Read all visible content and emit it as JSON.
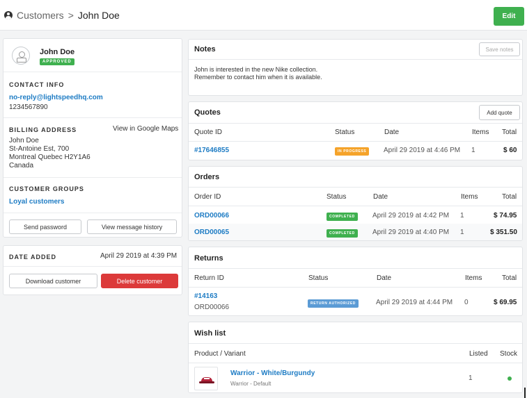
{
  "breadcrumb": {
    "parent": "Customers",
    "separator": ">",
    "current": "John Doe"
  },
  "header": {
    "edit_label": "Edit"
  },
  "customer": {
    "name": "John Doe",
    "status": "APPROVED"
  },
  "contact": {
    "title": "CONTACT INFO",
    "email": "no-reply@lightspeedhq.com",
    "phone": "1234567890"
  },
  "billing": {
    "title": "BILLING ADDRESS",
    "maps_link": "View in Google Maps",
    "lines": [
      "John Doe",
      "St-Antoine Est, 700",
      "Montreal Quebec H2Y1A6",
      "Canada"
    ]
  },
  "groups": {
    "title": "CUSTOMER GROUPS",
    "value": "Loyal customers"
  },
  "actions": {
    "send_password": "Send password",
    "view_history": "View message history"
  },
  "date_added": {
    "title": "DATE ADDED",
    "value": "April 29 2019 at 4:39 PM"
  },
  "actions2": {
    "download": "Download customer",
    "delete": "Delete customer"
  },
  "notes": {
    "title": "Notes",
    "save_label": "Save notes",
    "lines": [
      "John is interested in the new Nike collection.",
      "Remember to contact him when it is available."
    ]
  },
  "quotes": {
    "title": "Quotes",
    "add_label": "Add quote",
    "headers": {
      "id": "Quote ID",
      "status": "Status",
      "date": "Date",
      "items": "Items",
      "total": "Total"
    },
    "rows": [
      {
        "id": "#17646855",
        "status": "IN PROGRESS",
        "date": "April 29 2019 at 4:46 PM",
        "items": "1",
        "total": "$ 60"
      }
    ]
  },
  "orders": {
    "title": "Orders",
    "headers": {
      "id": "Order ID",
      "status": "Status",
      "date": "Date",
      "items": "Items",
      "total": "Total"
    },
    "rows": [
      {
        "id": "ORD00066",
        "status": "COMPLETED",
        "date": "April 29 2019 at 4:42 PM",
        "items": "1",
        "total": "$ 74.95"
      },
      {
        "id": "ORD00065",
        "status": "COMPLETED",
        "date": "April 29 2019 at 4:40 PM",
        "items": "1",
        "total": "$ 351.50"
      }
    ]
  },
  "returns": {
    "title": "Returns",
    "headers": {
      "id": "Return ID",
      "status": "Status",
      "date": "Date",
      "items": "Items",
      "total": "Total"
    },
    "rows": [
      {
        "id": "#14163",
        "order": "ORD00066",
        "status": "RETURN AUTHORIZED",
        "date": "April 29 2019 at 4:44 PM",
        "items": "0",
        "total": "$ 69.95"
      }
    ]
  },
  "wishlist": {
    "title": "Wish list",
    "headers": {
      "product": "Product / Variant",
      "listed": "Listed",
      "stock": "Stock"
    },
    "rows": [
      {
        "name": "Warrior - White/Burgundy",
        "variant": "Warrior - Default",
        "listed": "1",
        "stock_icon": "in-stock-dot"
      }
    ]
  },
  "colors": {
    "accent_green": "#3fb04f",
    "link_blue": "#1e7cc4",
    "danger_red": "#dc3a3a",
    "progress_orange": "#f5a32a",
    "return_blue": "#5b9bd5"
  }
}
